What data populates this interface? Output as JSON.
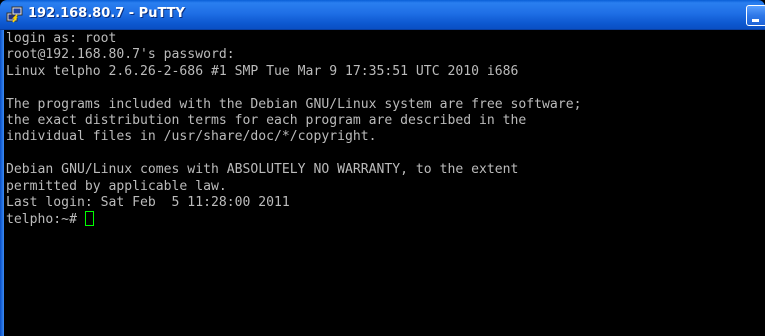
{
  "window": {
    "title": "192.168.80.7 - PuTTY",
    "icon": "putty-icon"
  },
  "terminal": {
    "lines": [
      "login as: root",
      "root@192.168.80.7's password:",
      "Linux telpho 2.6.26-2-686 #1 SMP Tue Mar 9 17:35:51 UTC 2010 i686",
      "",
      "The programs included with the Debian GNU/Linux system are free software;",
      "the exact distribution terms for each program are described in the",
      "individual files in /usr/share/doc/*/copyright.",
      "",
      "Debian GNU/Linux comes with ABSOLUTELY NO WARRANTY, to the extent",
      "permitted by applicable law.",
      "Last login: Sat Feb  5 11:28:00 2011"
    ],
    "prompt": "telpho:~# ",
    "text_color": "#bbbbbb",
    "cursor_color": "#00ff00",
    "background": "#000000"
  }
}
